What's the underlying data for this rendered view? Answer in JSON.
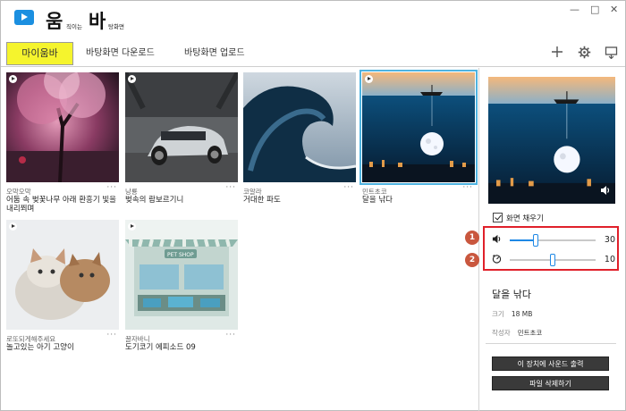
{
  "app": {
    "logo_big_1": "움",
    "logo_small_1": "직이는",
    "logo_big_2": "바",
    "logo_small_2": "탕화면"
  },
  "window_controls": [
    "—",
    "□",
    "✕"
  ],
  "tabs": [
    {
      "label": "마이움바",
      "active": true
    },
    {
      "label": "바탕화면 다운로드",
      "active": false
    },
    {
      "label": "바탕화면 업로드",
      "active": false
    }
  ],
  "toolbar": {
    "add_icon": "plus-icon",
    "settings_icon": "gear-icon",
    "window_icon": "window-icon"
  },
  "cards": [
    {
      "author": "오막오막",
      "title": "어둠 속 벚꽃나무 아래 환흥기 빛을 내리쬐며"
    },
    {
      "author": "낭룡",
      "title": "벚속의 람보르기니"
    },
    {
      "author": "코알라",
      "title": "거대한 파도"
    },
    {
      "author": "민트초코",
      "title": "달을 낚다"
    },
    {
      "author": "로또되게해주세요",
      "title": "놀고있는 아기 고양이"
    },
    {
      "author": "꿀자바니",
      "title": "도기코기 에피소드 09"
    }
  ],
  "card_more": "···",
  "panel": {
    "fill_screen_label": "화면 채우기",
    "fill_screen_checked": true,
    "marker_1": "1",
    "marker_2": "2",
    "volume_value": "30",
    "volume_fraction": 0.3,
    "speed_value": "10",
    "speed_fraction": 0.5,
    "selected_title": "달을 낚다",
    "size_label": "크기",
    "size_value": "18 MB",
    "creator_label": "작성자",
    "creator_value": "민트초코",
    "sound_button": "이 장치에 사운드 출력",
    "delete_button": "파일 삭제하기"
  },
  "colors": {
    "active_tab": "#f5f42d",
    "accent": "#1e88e5",
    "highlight_box": "#e0202a",
    "marker": "#c9573e",
    "button": "#3a3a3a"
  }
}
